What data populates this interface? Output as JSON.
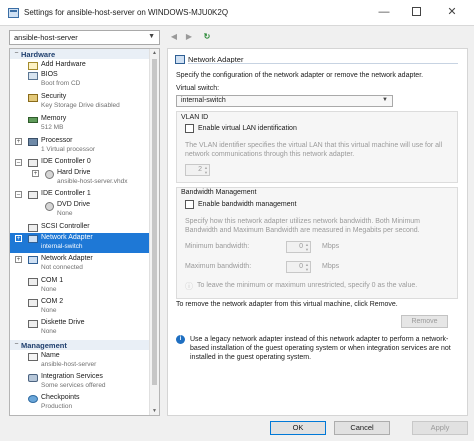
{
  "window": {
    "title": "Settings for ansible-host-server on WINDOWS-MJU0K2Q"
  },
  "vm_selector": {
    "value": "ansible-host-server"
  },
  "sidebar": {
    "hardware_header": "Hardware",
    "management_header": "Management",
    "hardware_items": [
      {
        "name": "Add Hardware",
        "sub": ""
      },
      {
        "name": "BIOS",
        "sub": "Boot from CD"
      },
      {
        "name": "Security",
        "sub": "Key Storage Drive disabled"
      },
      {
        "name": "Memory",
        "sub": "512 MB"
      },
      {
        "name": "Processor",
        "sub": "1 Virtual processor"
      },
      {
        "name": "IDE Controller 0",
        "sub": ""
      },
      {
        "name": "Hard Drive",
        "sub": "ansible-host-server.vhdx"
      },
      {
        "name": "IDE Controller 1",
        "sub": ""
      },
      {
        "name": "DVD Drive",
        "sub": "None"
      },
      {
        "name": "SCSI Controller",
        "sub": ""
      },
      {
        "name": "Network Adapter",
        "sub": "internal-switch"
      },
      {
        "name": "Network Adapter",
        "sub": "Not connected"
      },
      {
        "name": "COM 1",
        "sub": "None"
      },
      {
        "name": "COM 2",
        "sub": "None"
      },
      {
        "name": "Diskette Drive",
        "sub": "None"
      }
    ],
    "management_items": [
      {
        "name": "Name",
        "sub": "ansible-host-server"
      },
      {
        "name": "Integration Services",
        "sub": "Some services offered"
      },
      {
        "name": "Checkpoints",
        "sub": "Production"
      }
    ]
  },
  "panel": {
    "title": "Network Adapter",
    "description": "Specify the configuration of the network adapter or remove the network adapter.",
    "virtual_switch_label": "Virtual switch:",
    "virtual_switch_value": "internal-switch",
    "vlan": {
      "header": "VLAN ID",
      "checkbox_label": "Enable virtual LAN identification",
      "help": "The VLAN identifier specifies the virtual LAN that this virtual machine will use for all network communications through this network adapter.",
      "value": "2"
    },
    "bandwidth": {
      "header": "Bandwidth Management",
      "checkbox_label": "Enable bandwidth management",
      "help": "Specify how this network adapter utilizes network bandwidth. Both Minimum Bandwidth and Maximum Bandwidth are measured in Megabits per second.",
      "min_label": "Minimum bandwidth:",
      "min_value": "0",
      "max_label": "Maximum bandwidth:",
      "max_value": "0",
      "unit": "Mbps",
      "note": "To leave the minimum or maximum unrestricted, specify 0 as the value."
    },
    "remove_text": "To remove the network adapter from this virtual machine, click Remove.",
    "remove_button": "Remove",
    "info_text": "Use a legacy network adapter instead of this network adapter to perform a network-based installation of the guest operating system or when integration services are not installed in the guest operating system."
  },
  "buttons": {
    "ok": "OK",
    "cancel": "Cancel",
    "apply": "Apply"
  }
}
